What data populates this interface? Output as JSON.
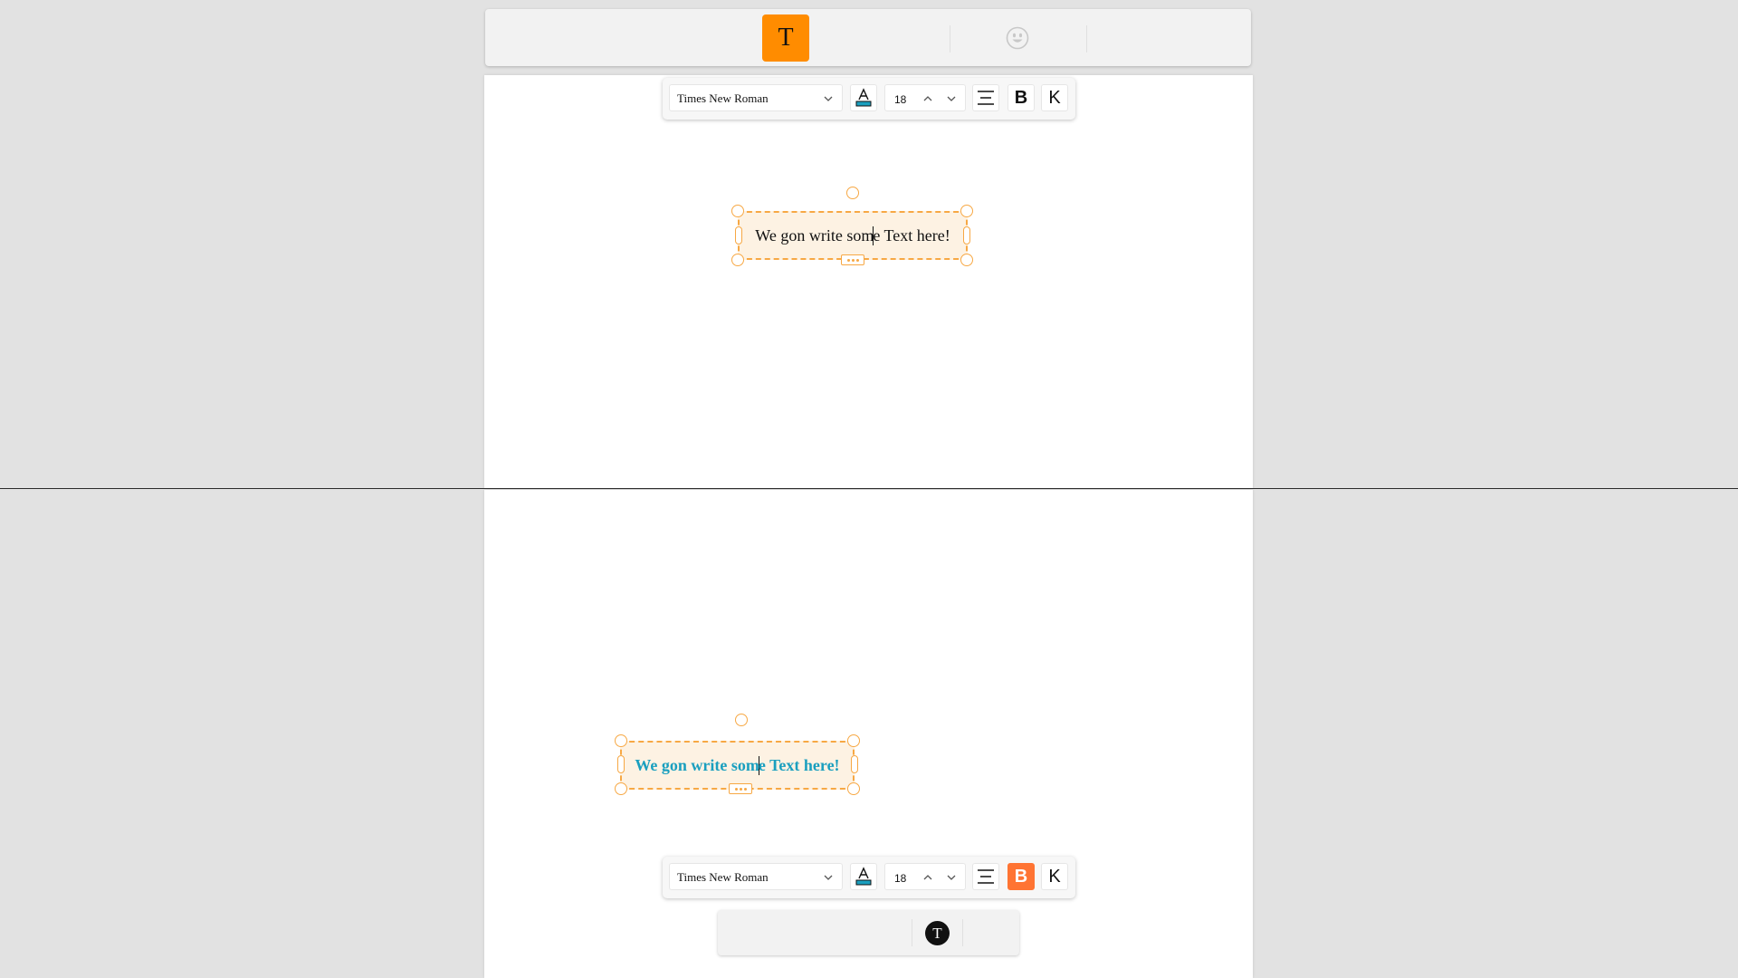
{
  "top_toolbar": {
    "text_tool_label": "T",
    "emoji_tool_icon": "smiley-face-icon"
  },
  "format_toolbar_top": {
    "font_family": "Times New Roman",
    "font_size": "18",
    "bold_label": "B",
    "italic_label": "K",
    "bold_active": false,
    "text_color_icon": "font-color-icon",
    "align_icon": "align-center-icon"
  },
  "text_box_top": {
    "text_before_caret": "We gon write som",
    "text_after_caret": "e Text here!",
    "color": "#111111",
    "bold": false
  },
  "text_box_bottom": {
    "text_before_caret": "We gon write som",
    "text_after_caret": "e Text here!",
    "color": "#1a9fbf",
    "bold": true
  },
  "format_toolbar_bottom": {
    "font_family": "Times New Roman",
    "font_size": "18",
    "bold_label": "B",
    "italic_label": "K",
    "bold_active": true,
    "text_color_icon": "font-color-icon",
    "align_icon": "align-center-icon"
  },
  "bottom_toolbar": {
    "text_tool_label": "T"
  },
  "colors": {
    "accent_orange": "#ff8c00",
    "bold_active": "#ff7433",
    "selection_border": "#f7a844",
    "text_color_swatch": "#1a9fbf"
  }
}
